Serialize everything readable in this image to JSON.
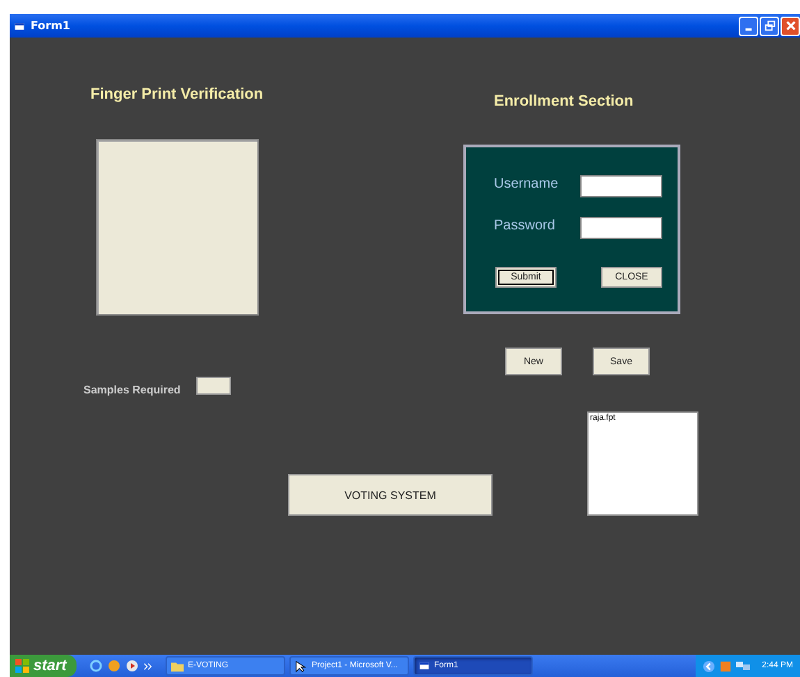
{
  "window": {
    "title": "Form1"
  },
  "verification": {
    "title": "Finger Print Verification",
    "samples_label": "Samples Required"
  },
  "enrollment": {
    "title": "Enrollment Section",
    "fields": [
      {
        "label": "Username"
      },
      {
        "label": "Password"
      }
    ],
    "buttons": [
      "Submit",
      "CLOSE"
    ]
  },
  "actions": [
    "New",
    "Save"
  ],
  "file_list": {
    "items": [
      "raja.fpt"
    ]
  },
  "main_button": "VOTING SYSTEM",
  "taskbar": {
    "start": "start",
    "tasks": [
      {
        "label": "E-VOTING",
        "kind": "folder",
        "selected": false
      },
      {
        "label": "Project1 - Microsoft V...",
        "kind": "app",
        "selected": false
      },
      {
        "label": "Form1",
        "kind": "form",
        "selected": true
      }
    ],
    "clock": "2:44 PM"
  }
}
